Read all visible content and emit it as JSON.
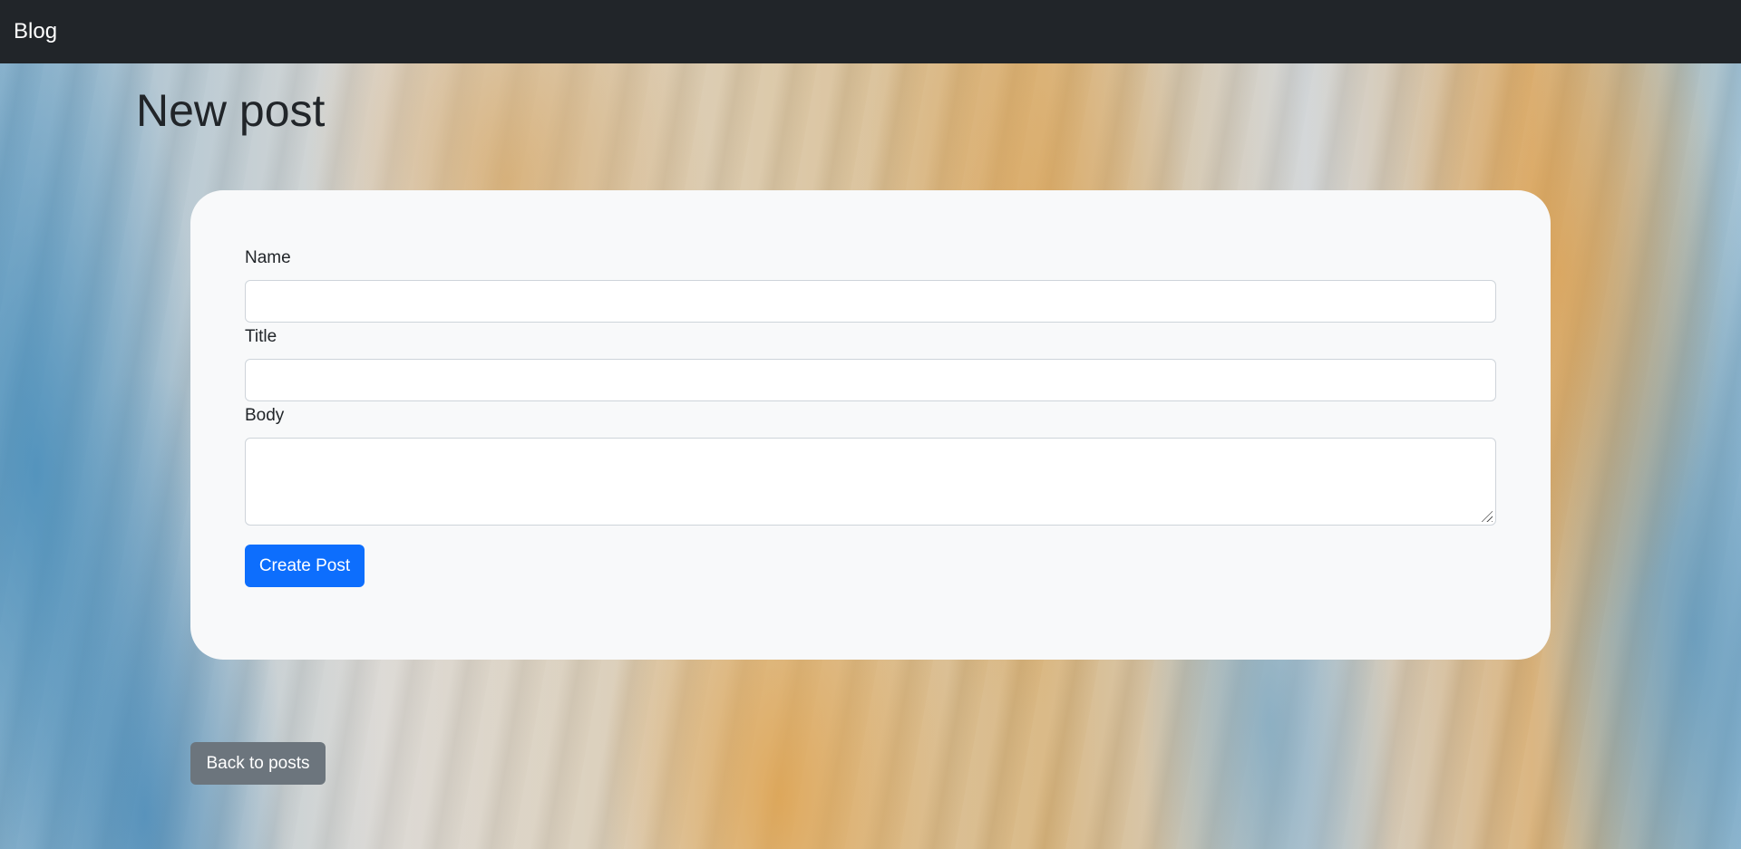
{
  "navbar": {
    "brand": "Blog"
  },
  "page": {
    "title": "New post"
  },
  "form": {
    "name_label": "Name",
    "name_value": "",
    "title_label": "Title",
    "title_value": "",
    "body_label": "Body",
    "body_value": "",
    "submit_label": "Create Post"
  },
  "footer": {
    "back_label": "Back to posts"
  },
  "colors": {
    "navbar": "#212529",
    "primary": "#0d6efd",
    "secondary": "#6c757d",
    "card": "#f8f9fa"
  }
}
